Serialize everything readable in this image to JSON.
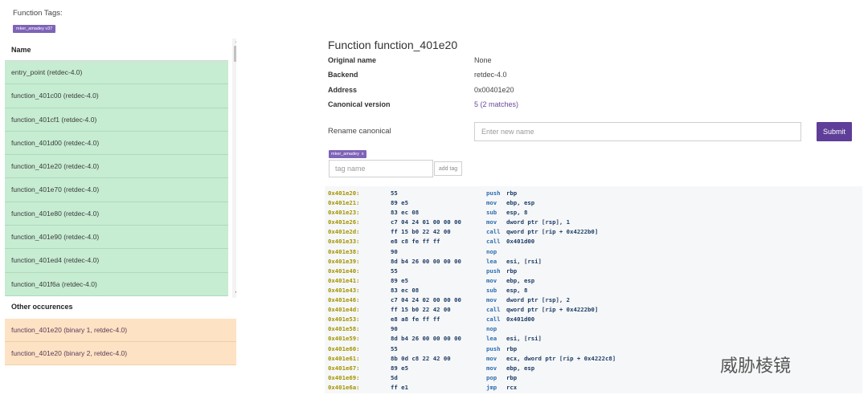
{
  "left": {
    "tags_title": "Function Tags:",
    "tag_chip": "mker_amadey v37",
    "list_header": "Name",
    "items": [
      "entry_point (retdec-4.0)",
      "function_401c00 (retdec-4.0)",
      "function_401cf1 (retdec-4.0)",
      "function_401d00 (retdec-4.0)",
      "function_401e20 (retdec-4.0)",
      "function_401e70 (retdec-4.0)",
      "function_401e80 (retdec-4.0)",
      "function_401e90 (retdec-4.0)",
      "function_401ed4 (retdec-4.0)",
      "function_401f6a (retdec-4.0)"
    ],
    "other_title": "Other occurences",
    "other_items": [
      "function_401e20 (binary 1, retdec-4.0)",
      "function_401e20 (binary 2, retdec-4.0)"
    ]
  },
  "right": {
    "title": "Function function_401e20",
    "info": [
      {
        "label": "Original name",
        "value": "None"
      },
      {
        "label": "Backend",
        "value": "retdec-4.0"
      },
      {
        "label": "Address",
        "value": "0x00401e20"
      },
      {
        "label": "Canonical version",
        "value": "5 (2 matches)"
      }
    ],
    "rename_label": "Rename canonical",
    "rename_placeholder": "Enter new name",
    "submit_label": "Submit",
    "tag_chip": "mker_amadey",
    "tag_close": "x",
    "tag_placeholder": "tag name",
    "add_tag_label": "add tag"
  },
  "code": [
    {
      "addr": "0x401e20:",
      "bytes": "55",
      "mnem": "push",
      "ops": "rbp"
    },
    {
      "addr": "0x401e21:",
      "bytes": "89 e5",
      "mnem": "mov",
      "ops": "ebp, esp"
    },
    {
      "addr": "0x401e23:",
      "bytes": "83 ec 08",
      "mnem": "sub",
      "ops": "esp, 8"
    },
    {
      "addr": "0x401e26:",
      "bytes": "c7 04 24 01 00 00 00",
      "mnem": "mov",
      "ops": "dword ptr [rsp], 1"
    },
    {
      "addr": "0x401e2d:",
      "bytes": "ff 15 b0 22 42 00",
      "mnem": "call",
      "ops": "qword ptr [rip + 0x4222b0]"
    },
    {
      "addr": "0x401e33:",
      "bytes": "e8 c8 fe ff ff",
      "mnem": "call",
      "ops": "0x401d00"
    },
    {
      "addr": "0x401e38:",
      "bytes": "90",
      "mnem": "nop",
      "ops": ""
    },
    {
      "addr": "0x401e39:",
      "bytes": "8d b4 26 00 00 00 00",
      "mnem": "lea",
      "ops": "esi, [rsi]"
    },
    {
      "addr": "0x401e40:",
      "bytes": "55",
      "mnem": "push",
      "ops": "rbp"
    },
    {
      "addr": "0x401e41:",
      "bytes": "89 e5",
      "mnem": "mov",
      "ops": "ebp, esp"
    },
    {
      "addr": "0x401e43:",
      "bytes": "83 ec 08",
      "mnem": "sub",
      "ops": "esp, 8"
    },
    {
      "addr": "0x401e46:",
      "bytes": "c7 04 24 02 00 00 00",
      "mnem": "mov",
      "ops": "dword ptr [rsp], 2"
    },
    {
      "addr": "0x401e4d:",
      "bytes": "ff 15 b0 22 42 00",
      "mnem": "call",
      "ops": "qword ptr [rip + 0x4222b0]"
    },
    {
      "addr": "0x401e53:",
      "bytes": "e8 a8 fe ff ff",
      "mnem": "call",
      "ops": "0x401d00"
    },
    {
      "addr": "0x401e58:",
      "bytes": "90",
      "mnem": "nop",
      "ops": ""
    },
    {
      "addr": "0x401e59:",
      "bytes": "8d b4 26 00 00 00 00",
      "mnem": "lea",
      "ops": "esi, [rsi]"
    },
    {
      "addr": "0x401e60:",
      "bytes": "55",
      "mnem": "push",
      "ops": "rbp"
    },
    {
      "addr": "0x401e61:",
      "bytes": "8b 0d c8 22 42 00",
      "mnem": "mov",
      "ops": "ecx, dword ptr [rip + 0x4222c8]"
    },
    {
      "addr": "0x401e67:",
      "bytes": "89 e5",
      "mnem": "mov",
      "ops": "ebp, esp"
    },
    {
      "addr": "0x401e69:",
      "bytes": "5d",
      "mnem": "pop",
      "ops": "rbp"
    },
    {
      "addr": "0x401e6a:",
      "bytes": "ff e1",
      "mnem": "jmp",
      "ops": "rcx"
    }
  ],
  "watermark": "威胁棱镜",
  "colors": {
    "list_green": "#c6ecd2",
    "other_orange": "#fde2c3",
    "accent_purple": "#5e3e98",
    "tag_purple": "#7e63b8",
    "code_bg": "#f6f7f8",
    "address_color": "#a39400",
    "mnemonic_color": "#2f6fb0"
  }
}
